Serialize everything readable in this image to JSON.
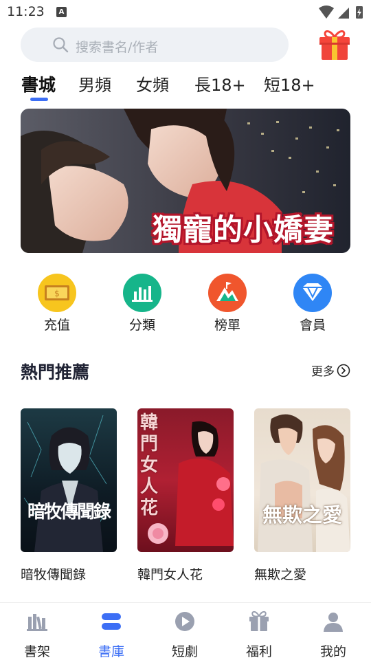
{
  "status_bar": {
    "time": "11:23",
    "notification_letter": "A"
  },
  "search": {
    "placeholder": "搜索書名/作者"
  },
  "tabs": [
    {
      "label": "書城",
      "active": true
    },
    {
      "label": "男頻",
      "active": false
    },
    {
      "label": "女頻",
      "active": false
    },
    {
      "label": "長18+",
      "active": false
    },
    {
      "label": "短18+",
      "active": false
    }
  ],
  "banner": {
    "caption": "獨寵的小嬌妻"
  },
  "quick_actions": [
    {
      "label": "充值",
      "icon": "coin-icon",
      "color": "#f7c51e"
    },
    {
      "label": "分類",
      "icon": "bar-chart-icon",
      "color": "#16b58a"
    },
    {
      "label": "榜單",
      "icon": "mountain-flag-icon",
      "color": "#f0562d"
    },
    {
      "label": "會員",
      "icon": "diamond-icon",
      "color": "#2f86f5"
    }
  ],
  "section": {
    "title": "熱門推薦",
    "more_label": "更多"
  },
  "books": [
    {
      "title": "暗牧傳聞錄",
      "cover_text": "暗牧傳聞錄"
    },
    {
      "title": "韓門女人花",
      "cover_text": "韓門女人花"
    },
    {
      "title": "無欺之愛",
      "cover_text": "無欺之愛"
    }
  ],
  "bottom_nav": [
    {
      "label": "書架",
      "icon": "bookshelf-icon",
      "active": false
    },
    {
      "label": "書庫",
      "icon": "library-icon",
      "active": true
    },
    {
      "label": "短劇",
      "icon": "play-icon",
      "active": false
    },
    {
      "label": "福利",
      "icon": "gift-icon",
      "active": false
    },
    {
      "label": "我的",
      "icon": "person-icon",
      "active": false
    }
  ],
  "colors": {
    "accent": "#3d6ff5",
    "gift": "#f5453a",
    "search_bg": "#eef1f5"
  }
}
